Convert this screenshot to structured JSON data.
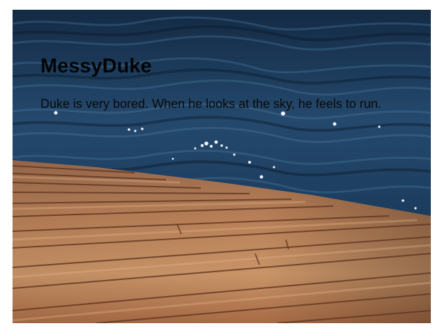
{
  "hero": {
    "title": "MessyDuke",
    "description": "Duke is very bored. When he looks at the sky, he feels to run."
  },
  "background": {
    "subject": "dark blue lake water with a wooden dock in the foreground",
    "colors": {
      "water_dark": "#0f2238",
      "water_mid": "#23476a",
      "water_light": "#3e6a8e",
      "wood_light": "#c08a61",
      "wood_mid": "#9a5f3c",
      "wood_dark": "#5e3520"
    }
  }
}
